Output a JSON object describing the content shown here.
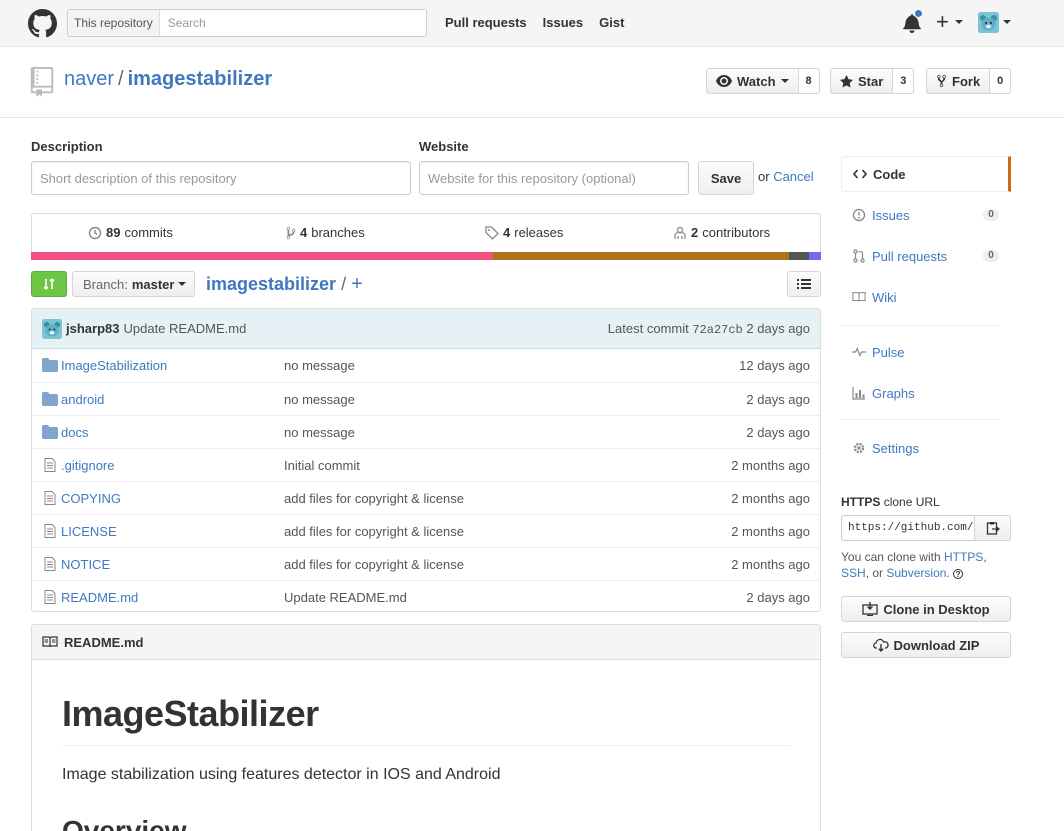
{
  "header": {
    "search_scope": "This repository",
    "search_placeholder": "Search",
    "nav": [
      "Pull requests",
      "Issues",
      "Gist"
    ],
    "plus_label": "+"
  },
  "repo": {
    "owner": "naver",
    "separator": "/",
    "name": "imagestabilizer",
    "watch_label": "Watch",
    "watch_count": "8",
    "star_label": "Star",
    "star_count": "3",
    "fork_label": "Fork",
    "fork_count": "0"
  },
  "edit": {
    "description_label": "Description",
    "description_placeholder": "Short description of this repository",
    "website_label": "Website",
    "website_placeholder": "Website for this repository (optional)",
    "save_label": "Save",
    "or_text": "or",
    "cancel_label": "Cancel"
  },
  "summary": {
    "commits_count": "89",
    "commits_label": "commits",
    "branches_count": "4",
    "branches_label": "branches",
    "releases_count": "4",
    "releases_label": "releases",
    "contributors_count": "2",
    "contributors_label": "contributors"
  },
  "language_bar": [
    {
      "color": "#f2517f",
      "share": 0.585
    },
    {
      "color": "#b07219",
      "share": 0.375
    },
    {
      "color": "#555555",
      "share": 0.025
    },
    {
      "color": "#6e6cf0",
      "share": 0.015
    }
  ],
  "file_nav": {
    "branch_prefix": "Branch:",
    "branch_name": "master",
    "path_root": "imagestabilizer",
    "path_sep": "/",
    "add_label": "+"
  },
  "latest_commit": {
    "author": "jsharp83",
    "message": "Update README.md",
    "prefix": "Latest commit",
    "sha": "72a27cb",
    "age": "2 days ago"
  },
  "files": [
    {
      "type": "dir",
      "name": "ImageStabilization",
      "message": "no message",
      "age": "12 days ago"
    },
    {
      "type": "dir",
      "name": "android",
      "message": "no message",
      "age": "2 days ago"
    },
    {
      "type": "dir",
      "name": "docs",
      "message": "no message",
      "age": "2 days ago"
    },
    {
      "type": "file",
      "name": ".gitignore",
      "message": "Initial commit",
      "age": "2 months ago"
    },
    {
      "type": "file",
      "name": "COPYING",
      "message": "add files for copyright & license",
      "age": "2 months ago"
    },
    {
      "type": "file",
      "name": "LICENSE",
      "message": "add files for copyright & license",
      "age": "2 months ago"
    },
    {
      "type": "file",
      "name": "NOTICE",
      "message": "add files for copyright & license",
      "age": "2 months ago"
    },
    {
      "type": "file",
      "name": "README.md",
      "message": "Update README.md",
      "age": "2 days ago"
    }
  ],
  "readme": {
    "filename": "README.md",
    "title": "ImageStabilizer",
    "description": "Image stabilization using features detector in IOS and Android",
    "section": "Overview"
  },
  "sidebar": {
    "items": [
      {
        "label": "Code",
        "icon": "code-icon"
      },
      {
        "label": "Issues",
        "icon": "issue-icon",
        "count": "0"
      },
      {
        "label": "Pull requests",
        "icon": "pull-request-icon",
        "count": "0"
      },
      {
        "label": "Wiki",
        "icon": "book-icon"
      },
      {
        "label": "Pulse",
        "icon": "pulse-icon"
      },
      {
        "label": "Graphs",
        "icon": "graph-icon"
      },
      {
        "label": "Settings",
        "icon": "gear-icon"
      }
    ],
    "clone_protocol": "HTTPS",
    "clone_suffix": "clone URL",
    "clone_url": "https://github.com/naver/imagestabilizer.git",
    "clone_help_prefix": "You can clone with",
    "clone_https": "HTTPS",
    "clone_ssh": "SSH",
    "clone_or": ", or",
    "clone_svn": "Subversion",
    "clone_desktop_label": "Clone in Desktop",
    "download_zip_label": "Download ZIP"
  }
}
